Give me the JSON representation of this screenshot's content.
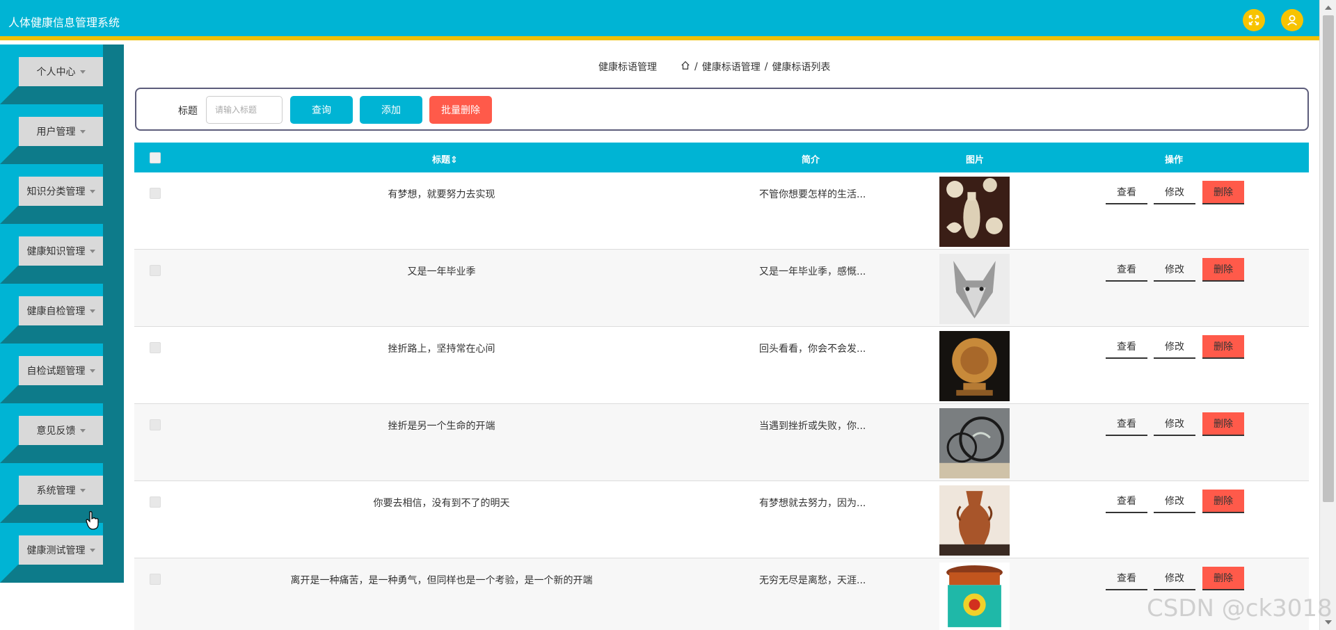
{
  "app": {
    "title": "人体健康信息管理系统"
  },
  "header": {
    "fullscreen_icon": "fullscreen-icon",
    "user_icon": "user-icon"
  },
  "sidebar": {
    "items": [
      {
        "label": "个人中心"
      },
      {
        "label": "用户管理"
      },
      {
        "label": "知识分类管理"
      },
      {
        "label": "健康知识管理"
      },
      {
        "label": "健康自检管理"
      },
      {
        "label": "自检试题管理"
      },
      {
        "label": "意见反馈"
      },
      {
        "label": "系统管理"
      },
      {
        "label": "健康测试管理"
      }
    ]
  },
  "breadcrumb": {
    "page": "健康标语管理",
    "crumb1": "健康标语管理",
    "sep": "/",
    "crumb2": "健康标语列表"
  },
  "search": {
    "label": "标题",
    "placeholder": "请输入标题",
    "query_label": "查询",
    "add_label": "添加",
    "batch_delete_label": "批量删除"
  },
  "table": {
    "headers": {
      "title": "标题⇕",
      "intro": "简介",
      "image": "图片",
      "ops": "操作"
    },
    "ops": {
      "view": "查看",
      "edit": "修改",
      "delete": "删除"
    },
    "rows": [
      {
        "title": "有梦想，就要努力去实现",
        "intro": "不管你想要怎样的生活..."
      },
      {
        "title": "又是一年毕业季",
        "intro": "又是一年毕业季，感慨..."
      },
      {
        "title": "挫折路上，坚持常在心间",
        "intro": "回头看看，你会不会发..."
      },
      {
        "title": "挫折是另一个生命的开端",
        "intro": "当遇到挫折或失败，你..."
      },
      {
        "title": "你要去相信，没有到不了的明天",
        "intro": "有梦想就去努力，因为..."
      },
      {
        "title": "离开是一种痛苦，是一种勇气，但同样也是一个考验，是一个新的开端",
        "intro": "无穷无尽是离愁，天涯..."
      }
    ]
  },
  "watermark": "CSDN @ck3018",
  "colors": {
    "primary": "#00b4d4",
    "accent": "#f7c300",
    "danger": "#ff5a4a",
    "sidebar_shade": "#0d7b8a"
  }
}
